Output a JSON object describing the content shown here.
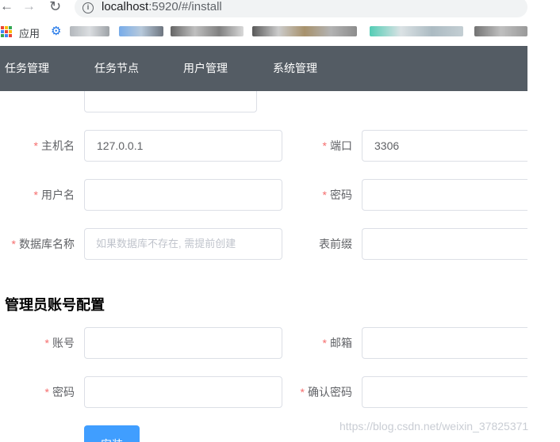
{
  "browser": {
    "url_host": "localhost",
    "url_rest": ":5920/#/install",
    "bookmarks_apps_label": "应用"
  },
  "topnav": {
    "items": [
      "任务管理",
      "任务节点",
      "用户管理",
      "系统管理"
    ],
    "background_color": "#545c64"
  },
  "db_form": {
    "host": {
      "label": "主机名",
      "value": "127.0.0.1",
      "required": true
    },
    "port": {
      "label": "端口",
      "value": "3306",
      "required": true
    },
    "username": {
      "label": "用户名",
      "value": "",
      "required": true
    },
    "password": {
      "label": "密码",
      "value": "",
      "required": true
    },
    "database": {
      "label": "数据库名称",
      "placeholder": "如果数据库不存在, 需提前创建",
      "required": true
    },
    "prefix": {
      "label": "表前缀",
      "value": "",
      "required": false
    }
  },
  "admin_section": {
    "title": "管理员账号配置",
    "account": {
      "label": "账号",
      "value": "",
      "required": true
    },
    "email": {
      "label": "邮箱",
      "value": "",
      "required": true
    },
    "password": {
      "label": "密码",
      "value": "",
      "required": true
    },
    "confirm_password": {
      "label": "确认密码",
      "value": "",
      "required": true
    }
  },
  "install_button": {
    "label": "安装",
    "color": "#409eff"
  },
  "watermark": "https://blog.csdn.net/weixin_37825371",
  "required_marker": "*",
  "colors": {
    "required": "#f56c6c",
    "border": "#dcdfe6",
    "placeholder": "#c0c4cc"
  }
}
